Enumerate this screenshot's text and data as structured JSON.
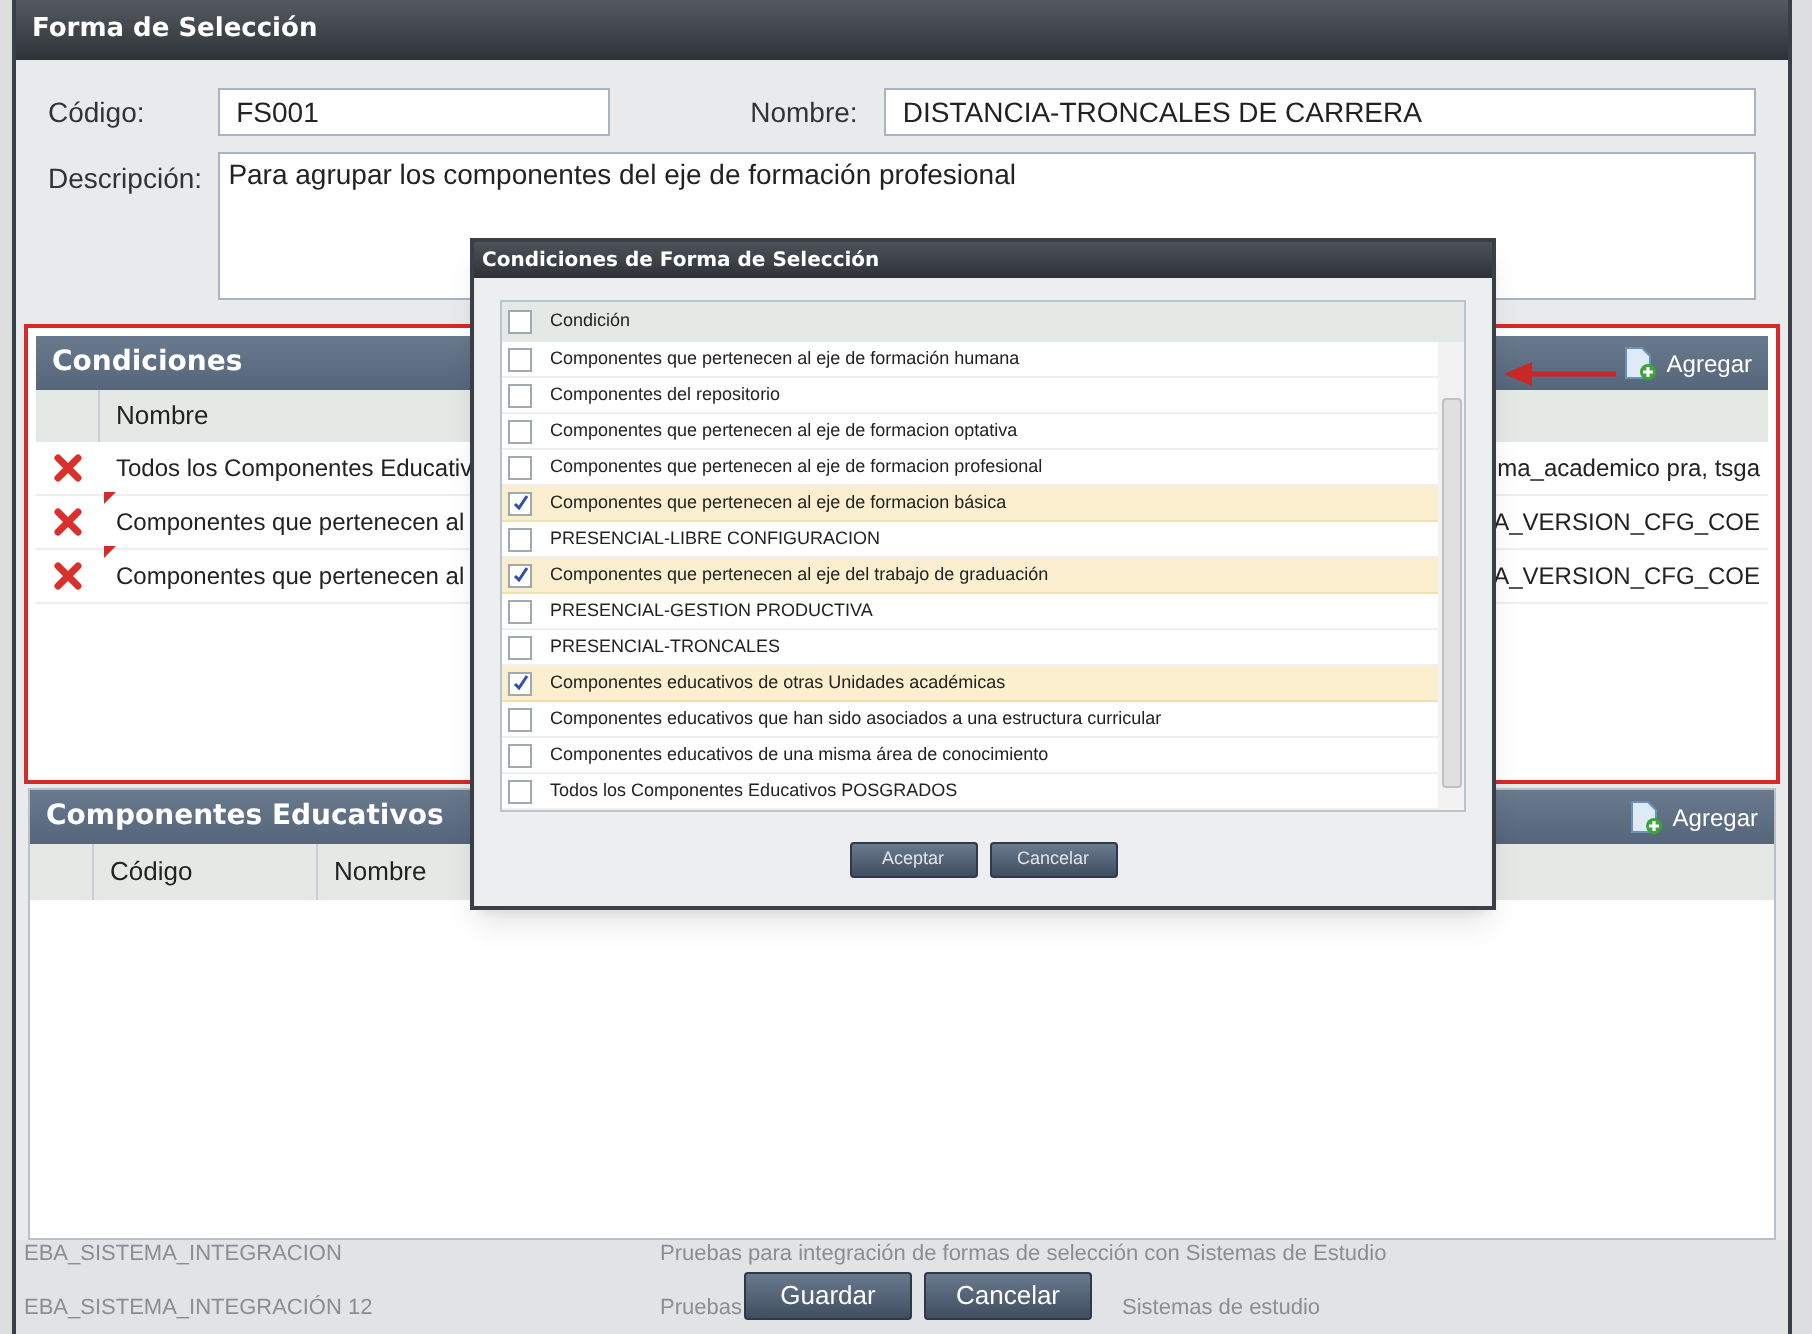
{
  "window": {
    "title": "Forma de Selección"
  },
  "form": {
    "codigo_label": "Código:",
    "codigo_value": "FS001",
    "nombre_label": "Nombre:",
    "nombre_value": "DISTANCIA-TRONCALES DE CARRERA",
    "descripcion_label": "Descripción:",
    "descripcion_value": "Para agrupar los componentes del eje de formación profesional"
  },
  "condiciones": {
    "title": "Condiciones",
    "add_label": "Agregar",
    "columns": [
      "Nombre"
    ],
    "rows": [
      {
        "nombre": "Todos los Componentes Educativ",
        "column_3": "ma_academico pra, tsga",
        "modified": false
      },
      {
        "nombre": "Componentes que pertenecen al",
        "column_3": "A_VERSION_CFG_COE",
        "modified": true
      },
      {
        "nombre": "Componentes que pertenecen al",
        "column_3": "A_VERSION_CFG_COE",
        "modified": true
      }
    ]
  },
  "componentes": {
    "title": "Componentes Educativos",
    "add_label": "Agregar",
    "columns": [
      "Código",
      "Nombre"
    ]
  },
  "background_rows": [
    {
      "column_1": "EBA_SISTEMA_INTEGRACION",
      "column_2": "Pruebas para integración de formas de selección con Sistemas de Estudio"
    },
    {
      "column_1": "EBA_SISTEMA_INTEGRACIÓN 12",
      "column_2": "Pruebas",
      "column_2_end": "Sistemas de estudio"
    }
  ],
  "buttons": [
    "Guardar",
    "Cancelar"
  ],
  "dialog": {
    "title": "Condiciones de Forma de Selección",
    "header_label": "Condición",
    "header_checked": false,
    "items": [
      {
        "label": "Componentes que pertenecen al eje de formación humana",
        "checked": false
      },
      {
        "label": "Componentes del repositorio",
        "checked": false
      },
      {
        "label": "Componentes que pertenecen al eje de formacion optativa",
        "checked": false
      },
      {
        "label": "Componentes que pertenecen al eje de formacion profesional",
        "checked": false
      },
      {
        "label": "Componentes que pertenecen al eje de formacion básica",
        "checked": true
      },
      {
        "label": "PRESENCIAL-LIBRE CONFIGURACION",
        "checked": false
      },
      {
        "label": "Componentes que pertenecen al eje del trabajo de graduación",
        "checked": true
      },
      {
        "label": "PRESENCIAL-GESTION PRODUCTIVA",
        "checked": false
      },
      {
        "label": "PRESENCIAL-TRONCALES",
        "checked": false
      },
      {
        "label": "Componentes educativos de otras Unidades académicas",
        "checked": true
      },
      {
        "label": "Componentes educativos que han sido asociados a una estructura curricular",
        "checked": false
      },
      {
        "label": "Componentes educativos de una misma área de conocimiento",
        "checked": false
      },
      {
        "label": "Todos los Componentes Educativos POSGRADOS",
        "checked": false
      }
    ],
    "buttons": [
      "Aceptar",
      "Cancelar"
    ]
  }
}
